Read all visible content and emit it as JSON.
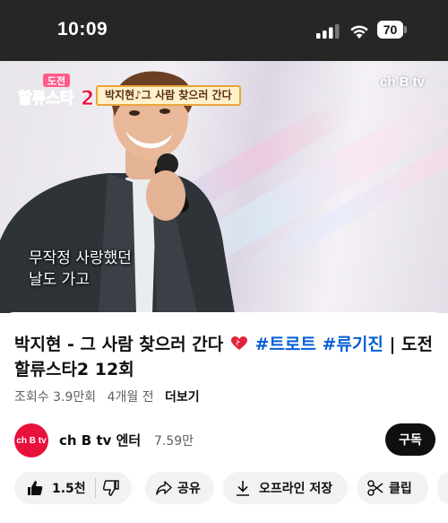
{
  "status_bar": {
    "time": "10:09",
    "battery": "70"
  },
  "video": {
    "logo_line1": "도전",
    "logo_line2": "할류스타2",
    "caption": "박지현♪그 사람 찾으러 간다",
    "watermark": "ch B tv",
    "subtitle": "무작정 사랑했던\n날도 가고"
  },
  "info": {
    "title_plain": "박지현 - 그 사람 찾으러 간다",
    "tag1": "#트로트",
    "tag2": "#류기진",
    "title_rest": "| 도전 할류스타2 12회",
    "views": "조회수 3.9만회",
    "age": "4개월 전",
    "more": "더보기",
    "channel": {
      "avatar_text": "ch B tv",
      "name": "ch B tv 엔터",
      "subscribers": "7.59만",
      "subscribe_label": "구독"
    },
    "actions": {
      "likes": "1.5천",
      "share": "공유",
      "offline": "오프라인 저장",
      "clip": "클립"
    }
  },
  "colors": {
    "accent_link": "#065fd4",
    "avatar_red": "#e8113b"
  }
}
